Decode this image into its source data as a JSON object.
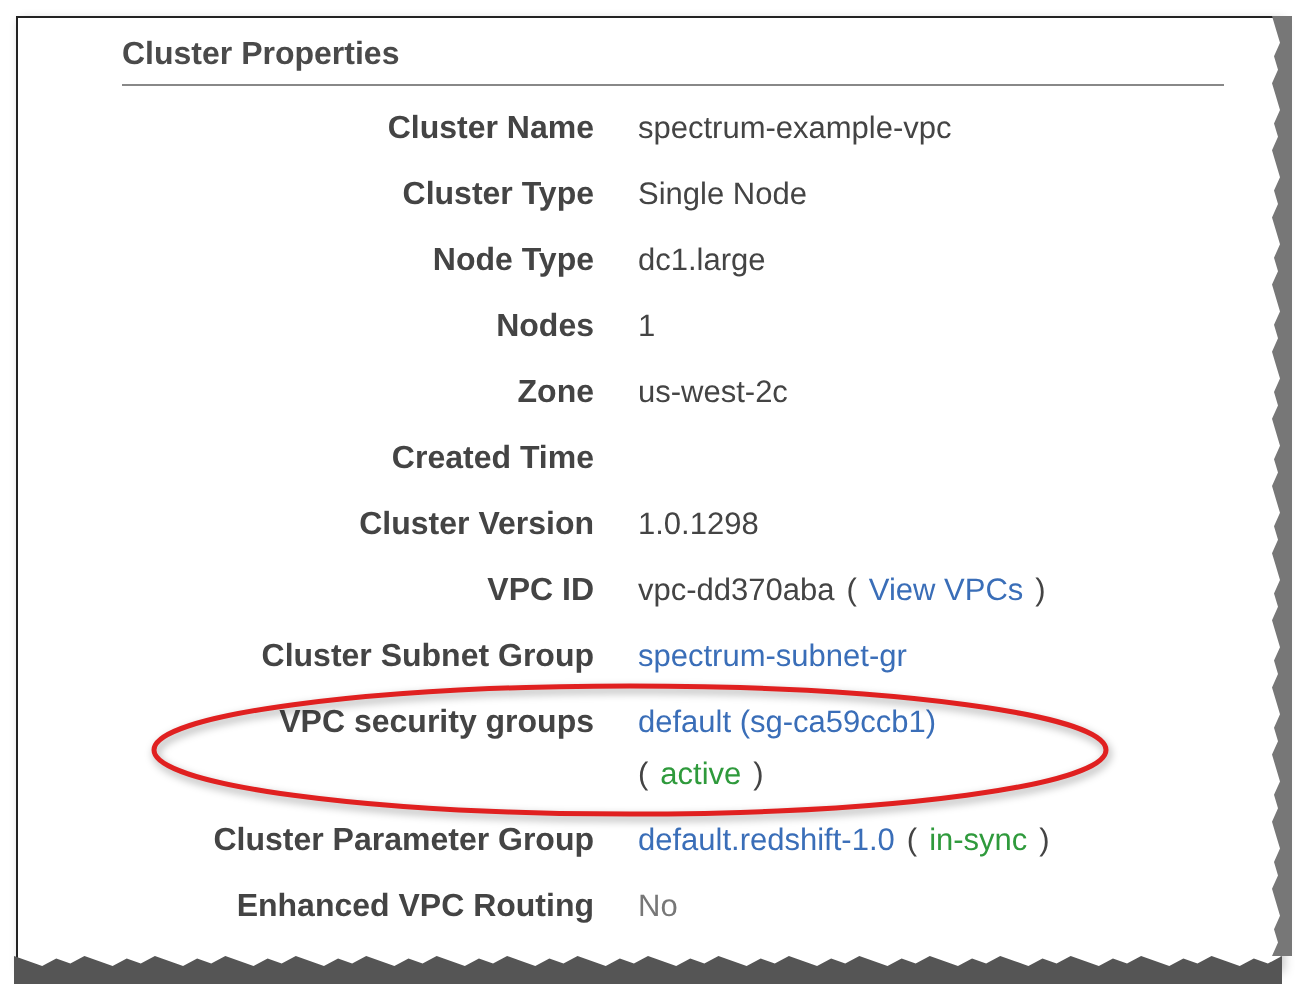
{
  "section": {
    "title": "Cluster Properties"
  },
  "rows": [
    {
      "label": "Cluster Name",
      "lines": [
        [
          {
            "text": "spectrum-example-vpc",
            "kind": "plain"
          }
        ]
      ]
    },
    {
      "label": "Cluster Type",
      "lines": [
        [
          {
            "text": "Single Node",
            "kind": "plain"
          }
        ]
      ]
    },
    {
      "label": "Node Type",
      "lines": [
        [
          {
            "text": "dc1.large",
            "kind": "plain"
          }
        ]
      ]
    },
    {
      "label": "Nodes",
      "lines": [
        [
          {
            "text": "1",
            "kind": "plain"
          }
        ]
      ]
    },
    {
      "label": "Zone",
      "lines": [
        [
          {
            "text": "us-west-2c",
            "kind": "plain"
          }
        ]
      ]
    },
    {
      "label": "Created Time",
      "lines": []
    },
    {
      "label": "Cluster Version",
      "lines": [
        [
          {
            "text": "1.0.1298",
            "kind": "plain"
          }
        ]
      ]
    },
    {
      "label": "VPC ID",
      "lines": [
        [
          {
            "text": "vpc-dd370aba",
            "kind": "plain"
          },
          {
            "text": "(",
            "kind": "plain"
          },
          {
            "text": "View VPCs",
            "kind": "link"
          },
          {
            "text": ")",
            "kind": "plain"
          }
        ]
      ]
    },
    {
      "label": "Cluster Subnet Group",
      "lines": [
        [
          {
            "text": "spectrum-subnet-gr",
            "kind": "link"
          }
        ]
      ]
    },
    {
      "label": "VPC security groups",
      "lines": [
        [
          {
            "text": "default (sg-ca59ccb1)",
            "kind": "link"
          }
        ],
        [
          {
            "text": "(",
            "kind": "plain"
          },
          {
            "text": "active",
            "kind": "status"
          },
          {
            "text": ")",
            "kind": "plain"
          }
        ]
      ]
    },
    {
      "label": "Cluster Parameter Group",
      "lines": [
        [
          {
            "text": "default.redshift-1.0",
            "kind": "link"
          },
          {
            "text": "(",
            "kind": "plain"
          },
          {
            "text": "in-sync",
            "kind": "status"
          },
          {
            "text": ")",
            "kind": "plain"
          }
        ]
      ]
    },
    {
      "label": "Enhanced VPC Routing",
      "lines": [
        [
          {
            "text": "No",
            "kind": "muted"
          }
        ]
      ]
    }
  ],
  "annotation": {
    "kind": "ellipse"
  }
}
